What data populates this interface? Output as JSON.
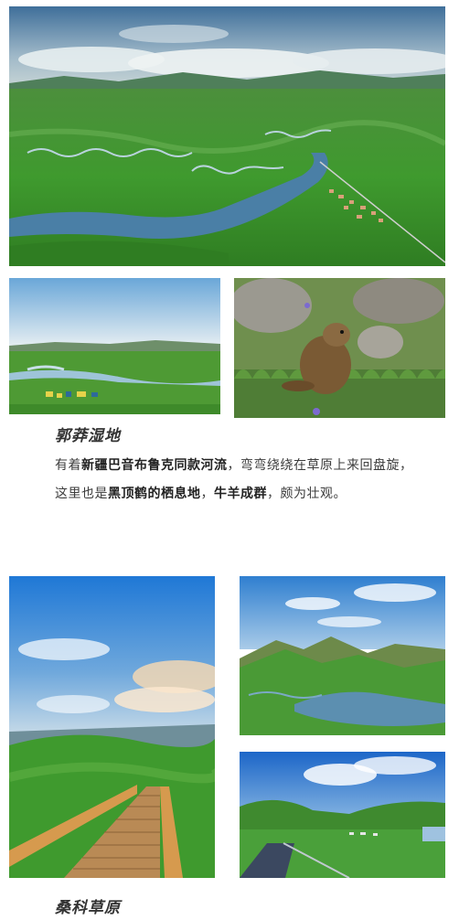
{
  "section1": {
    "heading": "郭莽湿地",
    "paragraph": [
      {
        "text": "有着",
        "bold": false
      },
      {
        "text": "新疆巴音布鲁克同款河流",
        "bold": true
      },
      {
        "text": "，弯弯绕绕在草原上来回盘旋，这里也是",
        "bold": false
      },
      {
        "text": "黑顶鹤的栖息地",
        "bold": true
      },
      {
        "text": "，",
        "bold": false
      },
      {
        "text": "牛羊成群",
        "bold": true
      },
      {
        "text": "，颇为壮观。",
        "bold": false
      }
    ]
  },
  "section2": {
    "heading": "桑科草原"
  },
  "colors": {
    "grass": "#3f9a2e",
    "sky": "#4a90d9",
    "river": "#4a7fa6",
    "text": "#3c3c3c"
  }
}
